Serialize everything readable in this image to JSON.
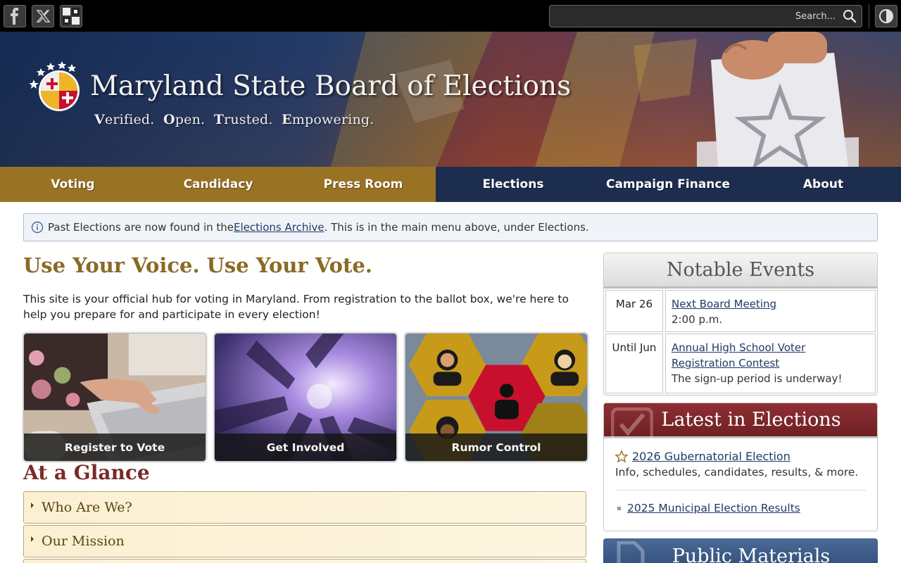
{
  "topbar": {
    "social": [
      {
        "name": "facebook-icon"
      },
      {
        "name": "x-twitter-icon"
      },
      {
        "name": "maryland-flag-icon"
      }
    ],
    "search_placeholder": "Search..."
  },
  "banner": {
    "title": "Maryland State Board of Elections",
    "tagline": {
      "w1_initial": "V",
      "w1_rest": "erified.",
      "w2_initial": "O",
      "w2_rest": "pen.",
      "w3_initial": "T",
      "w3_rest": "rusted.",
      "w4_initial": "E",
      "w4_rest": "mpowering."
    }
  },
  "nav": {
    "items": [
      {
        "label": "Voting"
      },
      {
        "label": "Candidacy"
      },
      {
        "label": "Press Room"
      },
      {
        "label": "Elections"
      },
      {
        "label": "Campaign Finance"
      },
      {
        "label": "About"
      }
    ]
  },
  "alert": {
    "before": "Past Elections are now found in the ",
    "link": "Elections Archive",
    "after": ". This is in the main menu above, under Elections."
  },
  "main": {
    "headline": "Use Your Voice. Use Your Vote.",
    "intro": "This site is your official hub for voting in Maryland. From registration to the ballot box, we're here to help you prepare for and participate in every election!",
    "tiles": [
      {
        "label": "Register to Vote"
      },
      {
        "label": "Get Involved"
      },
      {
        "label": "Rumor Control"
      }
    ],
    "glance_title": "At a Glance",
    "accordion": [
      {
        "label": "Who Are We?"
      },
      {
        "label": "Our Mission"
      }
    ]
  },
  "sidebar": {
    "events_title": "Notable Events",
    "events": [
      {
        "date": "Mar 26",
        "title": "Next Board Meeting",
        "detail": "2:00 p.m."
      },
      {
        "date": "Until Jun",
        "title": "Annual High School Voter Registration Contest",
        "detail": "The sign-up period is underway!"
      }
    ],
    "latest_title": "Latest in Elections",
    "latest_featured": {
      "title": "2026 Gubernatorial Election",
      "detail": "Info, schedules, candidates, results, & more."
    },
    "latest_list": [
      {
        "title": "2025 Municipal Election Results"
      }
    ],
    "public_title": "Public Materials"
  },
  "colors": {
    "nav_gold": "#9a7223",
    "nav_navy": "#1c2d4f",
    "headline_gold": "#8a6a25",
    "glance_maroon": "#7a2a2a",
    "link_blue": "#1f3a66"
  }
}
